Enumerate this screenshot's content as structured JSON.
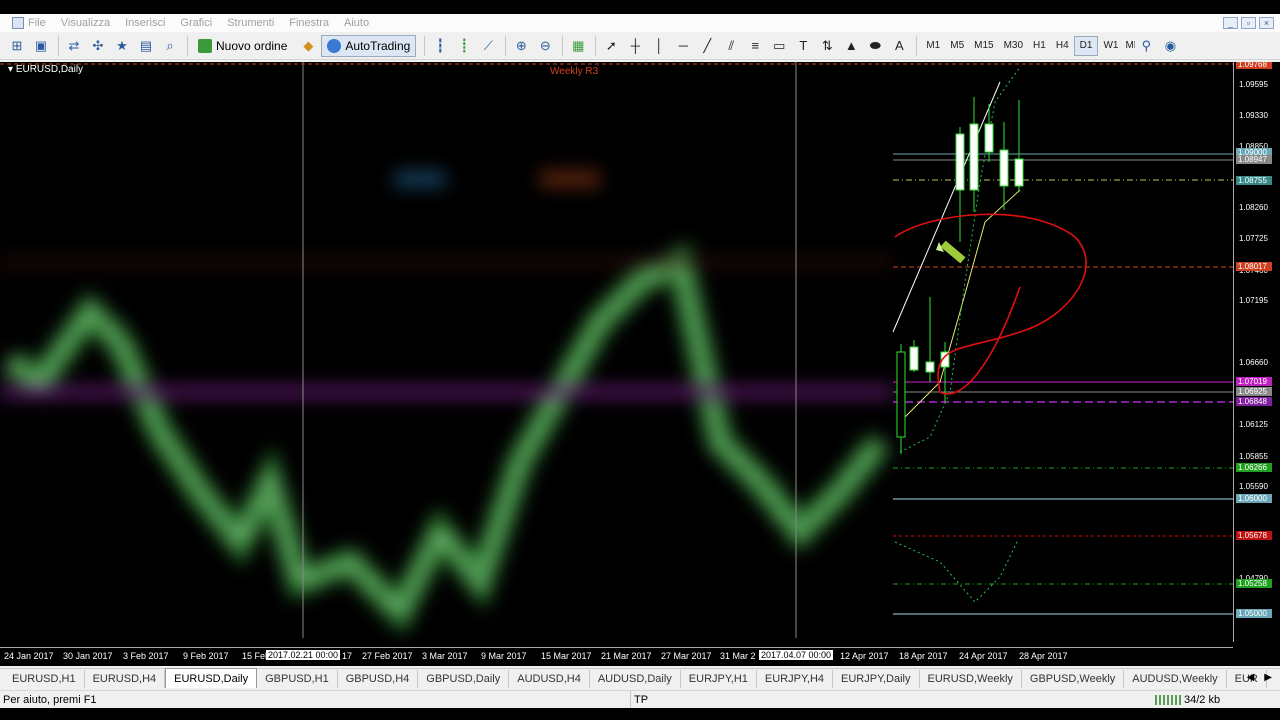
{
  "menu": [
    "File",
    "Visualizza",
    "Inserisci",
    "Grafici",
    "Strumenti",
    "Finestra",
    "Aiuto"
  ],
  "toolbar": {
    "new_order_label": "Nuovo ordine",
    "autotrading_label": "AutoTrading",
    "timeframes": [
      "M1",
      "M5",
      "M15",
      "M30",
      "H1",
      "H4",
      "D1",
      "W1",
      "MN"
    ],
    "active_timeframe": "D1"
  },
  "chart": {
    "title": "EURUSD,Daily",
    "weekly_label": "Weekly R3",
    "price_labels": [
      "1.09595",
      "1.09330",
      "1.08850",
      "1.08260",
      "1.07725",
      "1.07460",
      "1.07195",
      "1.06660",
      "1.06390",
      "1.06125",
      "1.05855",
      "1.05590",
      "1.04790"
    ],
    "price_tags": [
      {
        "text": "1.09768",
        "color": "#d04020"
      },
      {
        "text": "1.09000",
        "color": "#6aa8b8"
      },
      {
        "text": "1.08947",
        "color": "#888888"
      },
      {
        "text": "1.08755",
        "color": "#3a8a8a"
      },
      {
        "text": "1.08017",
        "color": "#d04020"
      },
      {
        "text": "1.07019",
        "color": "#c020c0"
      },
      {
        "text": "1.06925",
        "color": "#888888"
      },
      {
        "text": "1.06848",
        "color": "#8020a0"
      },
      {
        "text": "1.06266",
        "color": "#20a020"
      },
      {
        "text": "1.06000",
        "color": "#6aa8b8"
      },
      {
        "text": "1.05678",
        "color": "#c01010"
      },
      {
        "text": "1.05258",
        "color": "#20a020"
      },
      {
        "text": "1.05000",
        "color": "#6aa8b8"
      }
    ],
    "dates": [
      "24 Jan 2017",
      "30 Jan 2017",
      "3 Feb 2017",
      "9 Feb 2017",
      "15 Feb",
      "17",
      "27 Feb 2017",
      "3 Mar 2017",
      "9 Mar 2017",
      "15 Mar 2017",
      "21 Mar 2017",
      "27 Mar 2017",
      "31 Mar 2",
      "12 Apr 2017",
      "18 Apr 2017",
      "24 Apr 2017",
      "28 Apr 2017"
    ],
    "date_highlights": [
      "2017.02.21 00:00",
      "2017.04.07 00:00"
    ]
  },
  "tabs": [
    "EURUSD,H1",
    "EURUSD,H4",
    "EURUSD,Daily",
    "GBPUSD,H1",
    "GBPUSD,H4",
    "GBPUSD,Daily",
    "AUDUSD,H4",
    "AUDUSD,Daily",
    "EURJPY,H1",
    "EURJPY,H4",
    "EURJPY,Daily",
    "EURUSD,Weekly",
    "GBPUSD,Weekly",
    "AUDUSD,Weekly",
    "EUR"
  ],
  "active_tab": "EURUSD,Daily",
  "status": {
    "help": "Per aiuto, premi F1",
    "profile": "TP",
    "traffic": "34/2 kb"
  }
}
